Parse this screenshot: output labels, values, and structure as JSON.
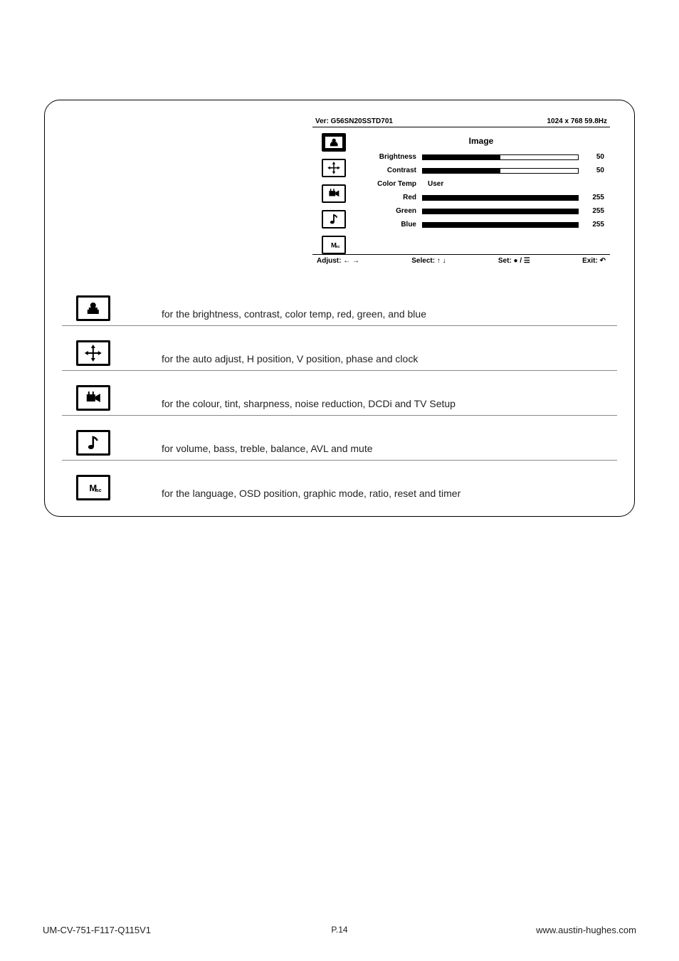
{
  "osd": {
    "ver_label": "Ver: G56SN20SSTD701",
    "resolution": "1024 x 768  59.8Hz",
    "title": "Image",
    "rows": {
      "brightness": {
        "label": "Brightness",
        "value": "50",
        "fill_pct": 50
      },
      "contrast": {
        "label": "Contrast",
        "value": "50",
        "fill_pct": 50
      },
      "colortemp": {
        "label": "Color Temp",
        "text": "User"
      },
      "red": {
        "label": "Red",
        "value": "255",
        "fill_pct": 100
      },
      "green": {
        "label": "Green",
        "value": "255",
        "fill_pct": 100
      },
      "blue": {
        "label": "Blue",
        "value": "255",
        "fill_pct": 100
      }
    },
    "footer": {
      "adjust": "Adjust: ← →",
      "select": "Select: ↑ ↓",
      "set": "Set: ● / ☰",
      "exit": "Exit: ↶"
    },
    "icons": [
      "image-icon",
      "geometry-icon",
      "video-icon",
      "audio-icon",
      "misc-icon"
    ]
  },
  "legend": [
    {
      "icon": "image-icon",
      "text": "for the brightness, contrast, color temp, red, green, and blue"
    },
    {
      "icon": "geometry-icon",
      "text": "for the auto adjust, H position, V position, phase and clock"
    },
    {
      "icon": "video-icon",
      "text": "for the colour, tint, sharpness, noise reduction, DCDi and TV Setup"
    },
    {
      "icon": "audio-icon",
      "text": "for volume, bass, treble, balance, AVL and mute"
    },
    {
      "icon": "misc-icon",
      "text": "for the language, OSD position, graphic mode, ratio, reset and timer"
    }
  ],
  "footer": {
    "left": "UM-CV-751-F117-Q115V1",
    "center": "P.14",
    "right": "www.austin-hughes.com"
  }
}
